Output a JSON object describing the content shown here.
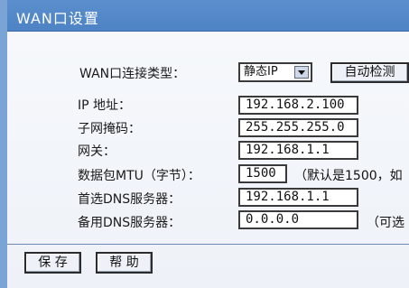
{
  "window": {
    "title": "WAN口设置"
  },
  "form": {
    "wan_type_label": "WAN口连接类型：",
    "wan_type_value": "静态IP",
    "autodetect_label": "自动检测",
    "ip_label": "IP 地址：",
    "ip_value": "192.168.2.100",
    "subnet_label": "子网掩码：",
    "subnet_value": "255.255.255.0",
    "gateway_label": "网关：",
    "gateway_value": "192.168.1.1",
    "mtu_label": "数据包MTU（字节）：",
    "mtu_value": "1500",
    "mtu_hint": "（默认是1500，如",
    "dns1_label": "首选DNS服务器：",
    "dns1_value": "192.168.1.1",
    "dns2_label": "备用DNS服务器：",
    "dns2_value": "0.0.0.0",
    "dns2_hint": "（可选"
  },
  "footer": {
    "save_label": "保 存",
    "help_label": "帮 助"
  },
  "colors": {
    "title_bar": "#4d82c4",
    "page_bg": "#f4f7fb"
  }
}
